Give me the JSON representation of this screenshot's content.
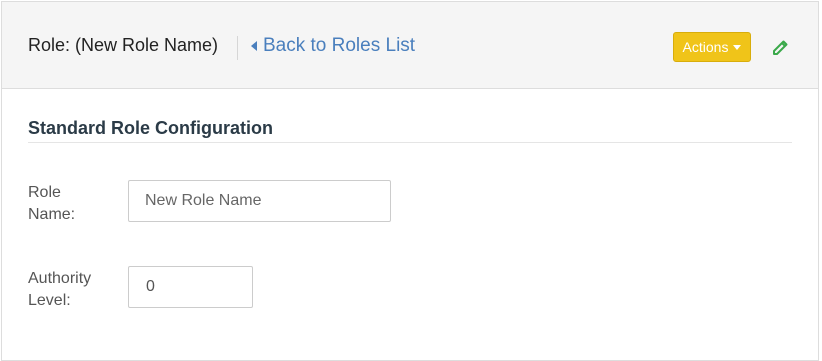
{
  "header": {
    "role_title": "Role: (New Role Name)",
    "back_link_label": "Back to Roles List",
    "actions_label": "Actions",
    "accent_color": "#f0c419",
    "back_link_color": "#4a7fbd",
    "edit_icon": "pencil-icon",
    "edit_icon_color": "#3aa94a"
  },
  "section": {
    "title": "Standard Role Configuration"
  },
  "form": {
    "role_name": {
      "label_line1": "Role",
      "label_line2": "Name:",
      "placeholder": "New Role Name",
      "value": ""
    },
    "authority_level": {
      "label_line1": "Authority",
      "label_line2": "Level:",
      "value": "0"
    }
  }
}
